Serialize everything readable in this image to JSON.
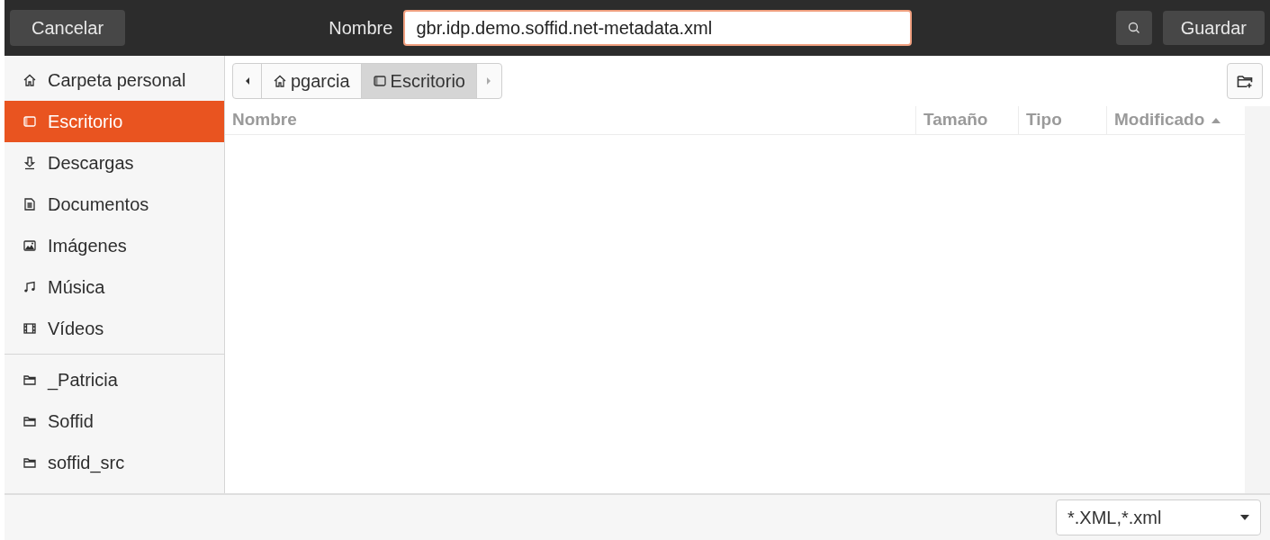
{
  "header": {
    "cancel": "Cancelar",
    "name_label": "Nombre",
    "name_value": "gbr.idp.demo.soffid.net-metadata.xml",
    "save": "Guardar"
  },
  "sidebar": {
    "places": [
      {
        "label": "Carpeta personal",
        "selected": false
      },
      {
        "label": "Escritorio",
        "selected": true
      },
      {
        "label": "Descargas",
        "selected": false
      },
      {
        "label": "Documentos",
        "selected": false
      },
      {
        "label": "Imágenes",
        "selected": false
      },
      {
        "label": "Música",
        "selected": false
      },
      {
        "label": "Vídeos",
        "selected": false
      }
    ],
    "bookmarks": [
      {
        "label": "_Patricia",
        "selected": false
      },
      {
        "label": "Soffid",
        "selected": false
      },
      {
        "label": "soffid_src",
        "selected": false
      }
    ]
  },
  "path_bar": [
    {
      "label": "pgarcia",
      "selected": false
    },
    {
      "label": "Escritorio",
      "selected": true
    }
  ],
  "table": {
    "columns": [
      {
        "label": "Nombre",
        "sorted": false
      },
      {
        "label": "Tamaño",
        "sorted": false
      },
      {
        "label": "Tipo",
        "sorted": false
      },
      {
        "label": "Modificado",
        "sorted": true
      }
    ]
  },
  "filter": {
    "value": "*.XML,*.xml"
  }
}
